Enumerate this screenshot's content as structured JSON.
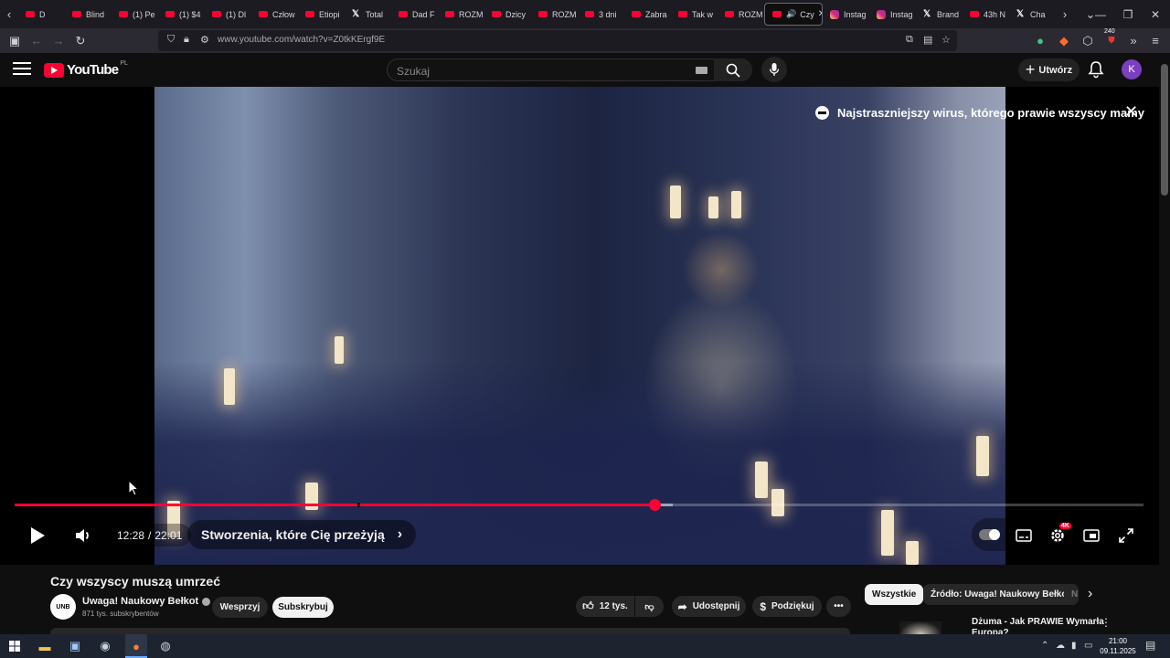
{
  "browser": {
    "tabs": [
      {
        "label": "D",
        "favicon": "youtube"
      },
      {
        "label": "Blind",
        "favicon": "youtube"
      },
      {
        "label": "(1) Pe",
        "favicon": "youtube"
      },
      {
        "label": "(1) $4",
        "favicon": "youtube"
      },
      {
        "label": "(1) Dl",
        "favicon": "youtube"
      },
      {
        "label": "Człow",
        "favicon": "youtube"
      },
      {
        "label": "Etiopi",
        "favicon": "youtube"
      },
      {
        "label": "Total",
        "favicon": "x"
      },
      {
        "label": "Dad F",
        "favicon": "youtube"
      },
      {
        "label": "ROZM",
        "favicon": "youtube"
      },
      {
        "label": "Dzicy",
        "favicon": "youtube"
      },
      {
        "label": "ROZM",
        "favicon": "youtube"
      },
      {
        "label": "3 dni",
        "favicon": "youtube"
      },
      {
        "label": "Zabra",
        "favicon": "youtube"
      },
      {
        "label": "Tak w",
        "favicon": "youtube"
      },
      {
        "label": "ROZM",
        "favicon": "youtube"
      }
    ],
    "active_tab": {
      "label": "Czy",
      "favicon": "youtube"
    },
    "tabs_after": [
      {
        "label": "Instag",
        "favicon": "instagram"
      },
      {
        "label": "Instag",
        "favicon": "instagram"
      },
      {
        "label": "Brand",
        "favicon": "x"
      },
      {
        "label": "43h N",
        "favicon": "youtube"
      },
      {
        "label": "Cha",
        "favicon": "x"
      }
    ],
    "url": "www.youtube.com/watch?v=Z0tkKErgf9E",
    "extension_badge": "240"
  },
  "header": {
    "logo_text": "YouTube",
    "country_code": "PL",
    "search_placeholder": "Szukaj",
    "create_label": "Utwórz",
    "avatar_letter": "K"
  },
  "player": {
    "endcard_title": "Najstraszniejszy wirus, którego prawie wszyscy mamy",
    "current_time": "12:28",
    "duration": "22:01",
    "time_separator": "/",
    "chapter_title": "Stworzenia, które Cię przeżyją",
    "quality_badge": "4K",
    "progress_fraction": 0.567,
    "buffer_fraction": 0.583
  },
  "video_info": {
    "title": "Czy wszyscy muszą umrzeć",
    "channel_logo_text": "UNB",
    "channel_name": "Uwaga! Naukowy Bełkot",
    "subscribers": "871 tys. subskrybentów",
    "support_label": "Wesprzyj",
    "subscribe_label": "Subskrybuj",
    "likes": "12 tys.",
    "share_label": "Udostępnij",
    "thanks_label": "Podziękuj"
  },
  "chips": [
    {
      "label": "Wszystkie"
    },
    {
      "label": "Źródło: Uwaga! Naukowy Bełkot"
    },
    {
      "label": "N"
    }
  ],
  "recommendation": {
    "title": "Dżuma - Jak PRAWIE Wymarła Europa?"
  },
  "taskbar": {
    "time": "21:00",
    "date": "09.11.2025"
  },
  "colors": {
    "youtube_red": "#ff0033",
    "background": "#0f0f0f"
  }
}
